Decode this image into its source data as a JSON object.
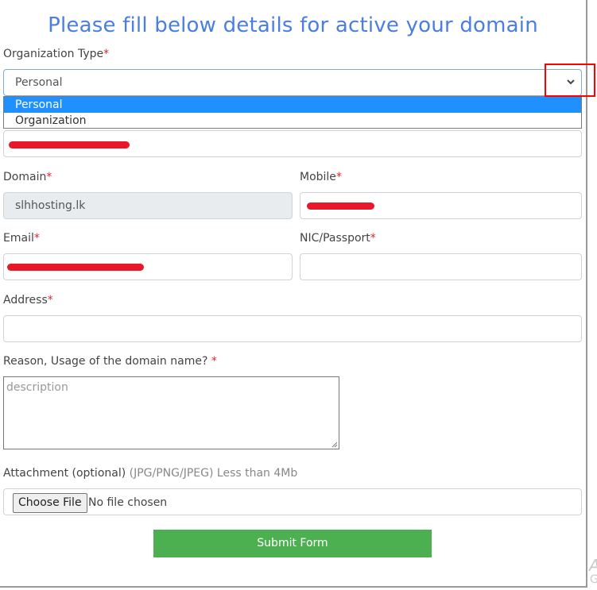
{
  "title": "Please fill below details for active your domain",
  "fields": {
    "org_type": {
      "label": "Organization Type",
      "required": "*",
      "value": "Personal",
      "options": [
        "Personal",
        "Organization"
      ],
      "selected": "Personal"
    },
    "full_name": {
      "value": "[redacted]"
    },
    "domain": {
      "label": "Domain",
      "required": "*",
      "value": "slhhosting.lk"
    },
    "mobile": {
      "label": "Mobile",
      "required": "*",
      "value": "[redacted]"
    },
    "email": {
      "label": "Email",
      "required": "*",
      "value": "[redacted]"
    },
    "nic": {
      "label": "NIC/Passport",
      "required": "*",
      "value": ""
    },
    "address": {
      "label": "Address",
      "required": "*",
      "value": ""
    },
    "reason": {
      "label": "Reason, Usage of the domain name?",
      "required": "*",
      "placeholder": "description"
    },
    "attachment": {
      "label": "Attachment (optional)",
      "hint": "(JPG/PNG/JPEG) Less than 4Mb",
      "button": "Choose File",
      "status": "No file chosen"
    }
  },
  "submit_label": "Submit Form",
  "watermark": {
    "line1": "A",
    "line2": "G"
  },
  "colors": {
    "title": "#4a7ee0",
    "required": "#e2242e",
    "submit": "#4caf50",
    "selected_option": "#1e90ff",
    "highlight_box": "#ff0000"
  }
}
